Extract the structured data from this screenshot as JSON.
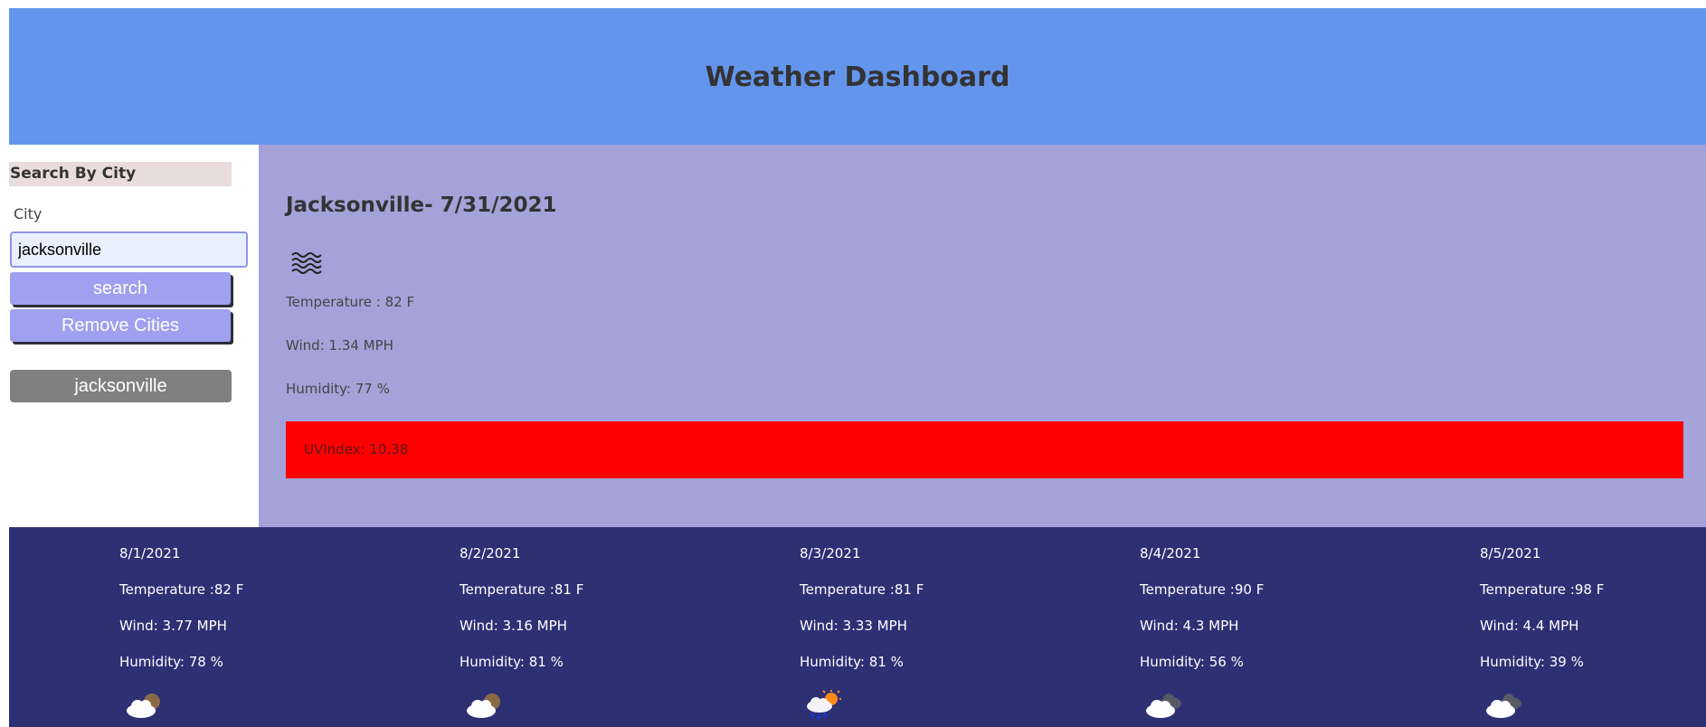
{
  "header": {
    "title": "Weather Dashboard"
  },
  "sidebar": {
    "heading": "Search By City",
    "city_label": "City",
    "city_value": "jacksonville",
    "search_label": "search",
    "remove_label": "Remove Cities",
    "history": [
      "jacksonville"
    ]
  },
  "current": {
    "title": "Jacksonville- 7/31/2021",
    "icon": "mist-icon",
    "temperature": "Temperature : 82 F",
    "wind": "Wind: 1.34 MPH",
    "humidity": "Humidity: 77 %",
    "uv": "UVIndex: 10.38",
    "uv_color": "#ff0000"
  },
  "forecast": [
    {
      "date": "8/1/2021",
      "temperature": "Temperature :82 F",
      "wind": "Wind: 3.77 MPH",
      "humidity": "Humidity: 78 %",
      "icon": "partly-cloudy-night-icon"
    },
    {
      "date": "8/2/2021",
      "temperature": "Temperature :81 F",
      "wind": "Wind: 3.16 MPH",
      "humidity": "Humidity: 81 %",
      "icon": "partly-cloudy-night-icon"
    },
    {
      "date": "8/3/2021",
      "temperature": "Temperature :81 F",
      "wind": "Wind: 3.33 MPH",
      "humidity": "Humidity: 81 %",
      "icon": "sun-rain-icon"
    },
    {
      "date": "8/4/2021",
      "temperature": "Temperature :90 F",
      "wind": "Wind: 4.3 MPH",
      "humidity": "Humidity: 56 %",
      "icon": "broken-clouds-icon"
    },
    {
      "date": "8/5/2021",
      "temperature": "Temperature :98 F",
      "wind": "Wind: 4.4 MPH",
      "humidity": "Humidity: 39 %",
      "icon": "broken-clouds-icon"
    }
  ],
  "colors": {
    "header_bg": "#6495ed",
    "current_bg": "#a3a3da",
    "forecast_bg": "#2e3074",
    "button_bg": "#9fa0ef",
    "history_bg": "#808080"
  }
}
